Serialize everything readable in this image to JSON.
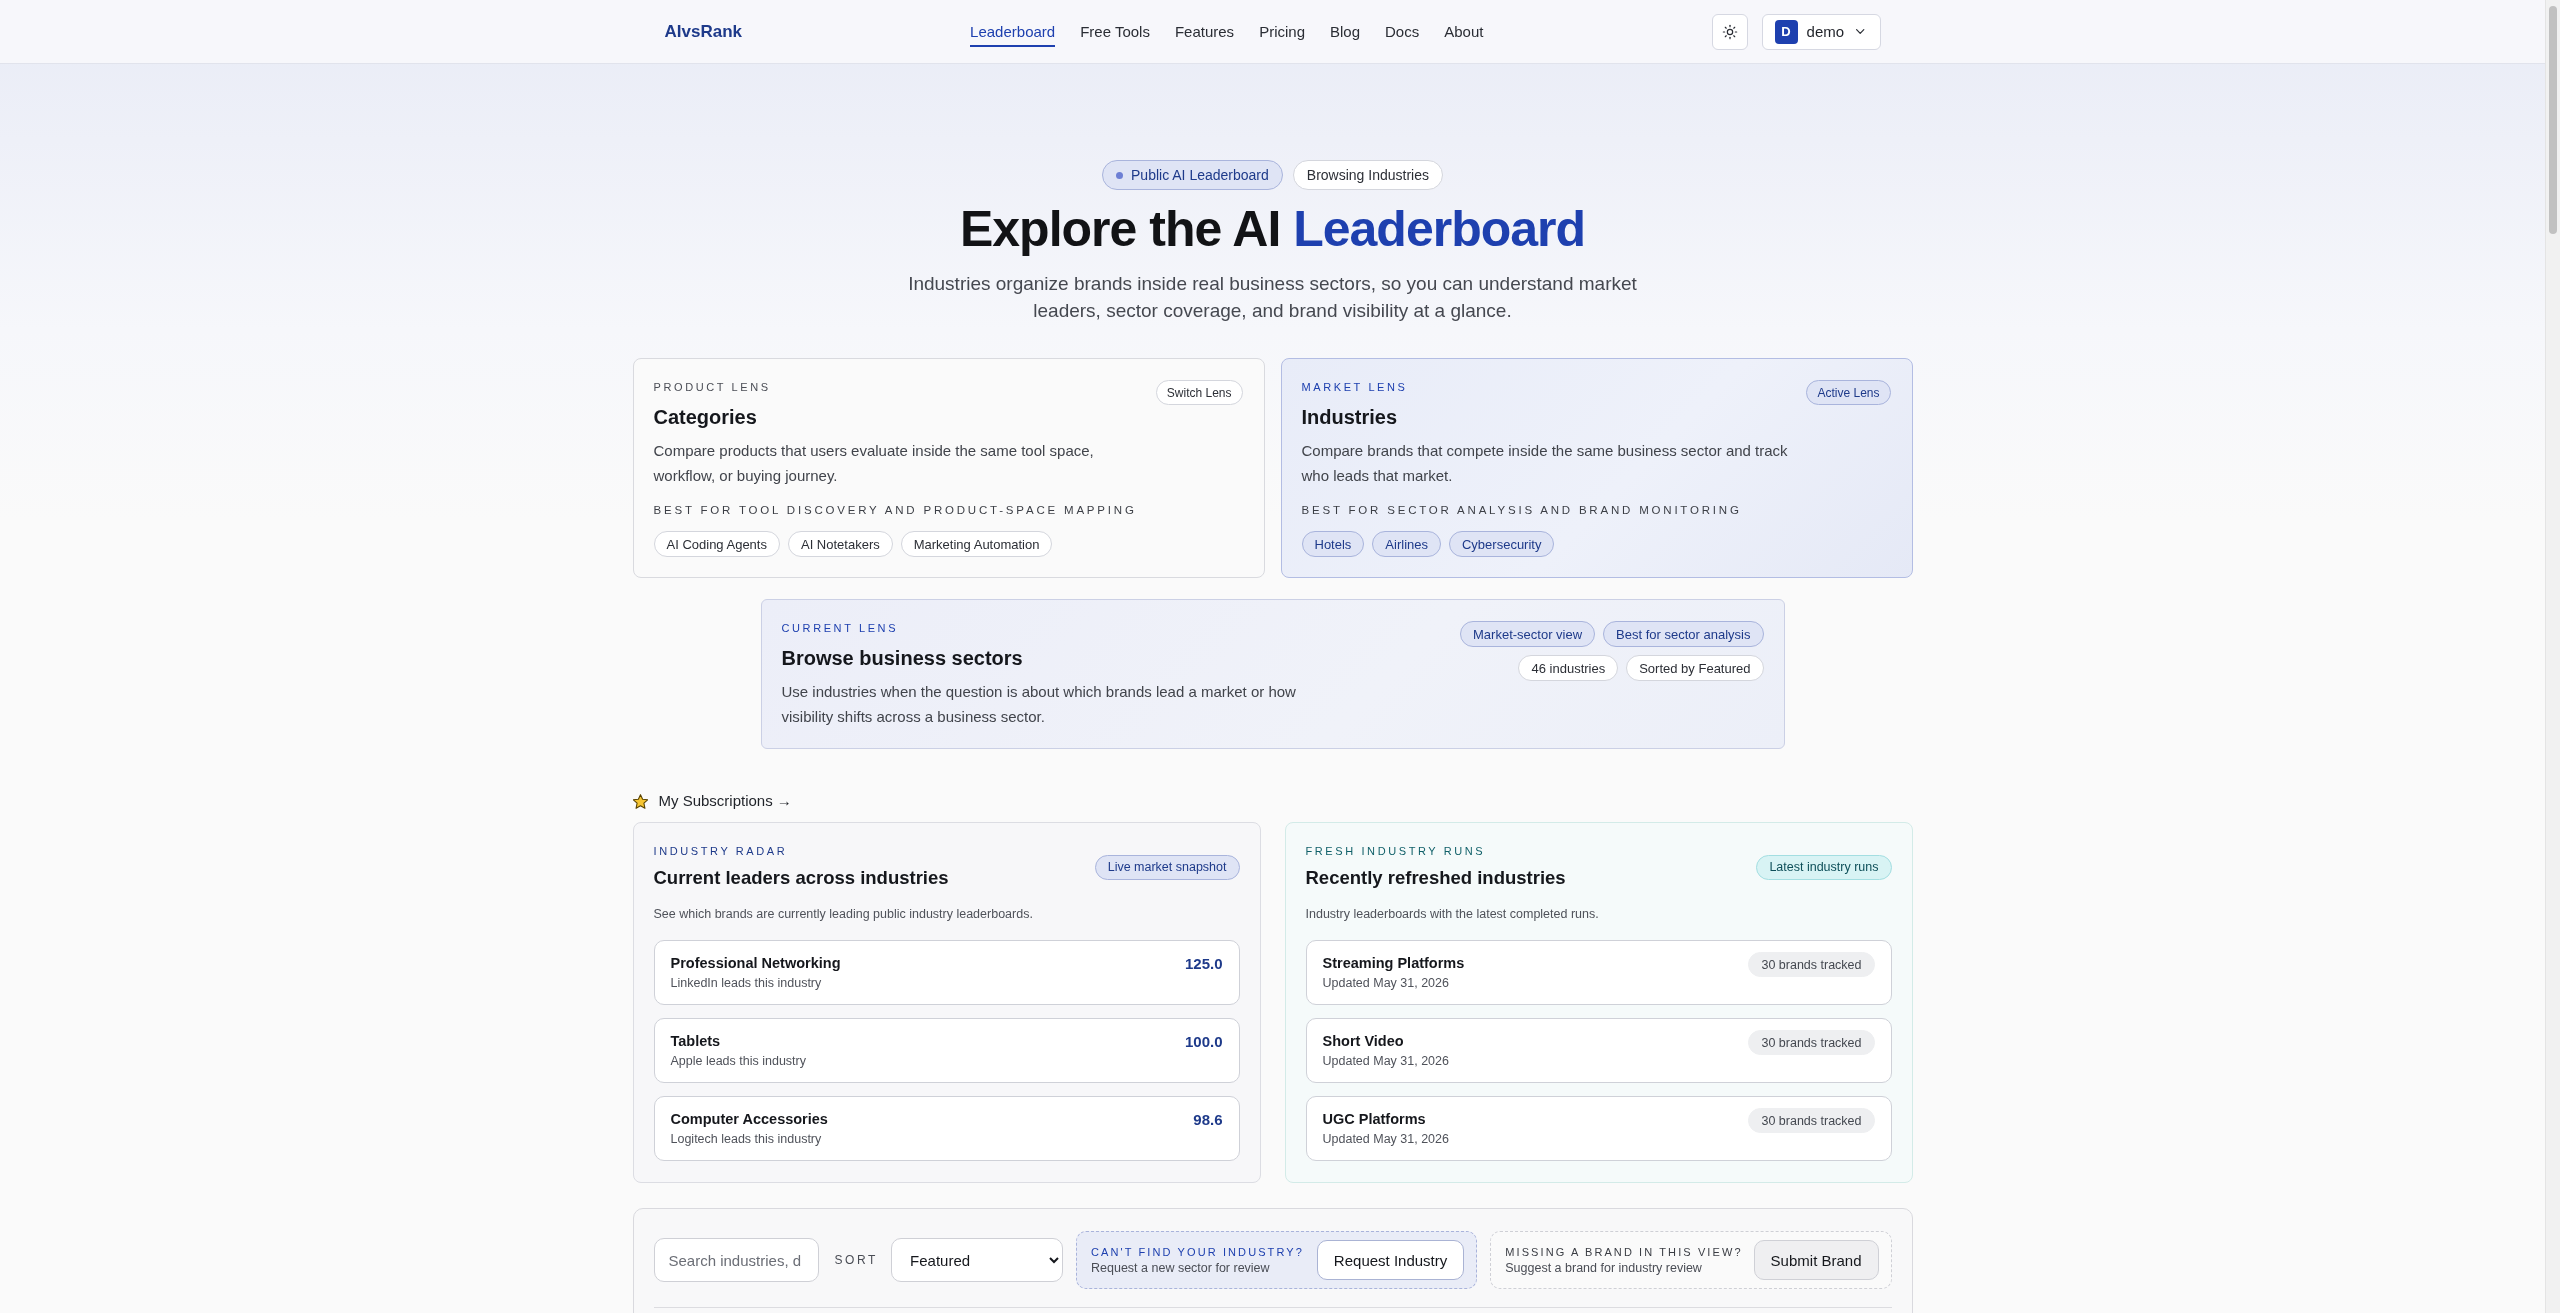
{
  "header": {
    "logo": "AIvsRank",
    "nav": [
      {
        "label": "Leaderboard",
        "selected": true
      },
      {
        "label": "Free Tools",
        "selected": false
      },
      {
        "label": "Features",
        "selected": false
      },
      {
        "label": "Pricing",
        "selected": false
      },
      {
        "label": "Blog",
        "selected": false
      },
      {
        "label": "Docs",
        "selected": false
      },
      {
        "label": "About",
        "selected": false
      }
    ],
    "account": {
      "initial": "D",
      "name": "demo"
    }
  },
  "hero": {
    "badges": [
      {
        "label": "Public AI Leaderboard",
        "kind": "accent"
      },
      {
        "label": "Browsing Industries",
        "kind": "plain"
      }
    ],
    "title": "Explore the AI",
    "title_highlight": "Leaderboard",
    "subtitle": "Industries organize brands inside real business sectors, so you can understand market leaders, sector coverage, and brand visibility at a glance."
  },
  "lenses": [
    {
      "eyebrow": "PRODUCT LENS",
      "title": "Categories",
      "status": "Switch Lens",
      "description": "Compare products that users evaluate inside the same tool space, workflow, or buying journey.",
      "best_for": "BEST FOR TOOL DISCOVERY AND PRODUCT-SPACE MAPPING",
      "examples": [
        "AI Coding Agents",
        "AI Notetakers",
        "Marketing Automation"
      ],
      "active": false
    },
    {
      "eyebrow": "MARKET LENS",
      "title": "Industries",
      "status": "Active Lens",
      "description": "Compare brands that compete inside the same business sector and track who leads that market.",
      "best_for": "BEST FOR SECTOR ANALYSIS AND BRAND MONITORING",
      "examples": [
        "Hotels",
        "Airlines",
        "Cybersecurity"
      ],
      "active": true
    }
  ],
  "current_lens": {
    "eyebrow": "CURRENT LENS",
    "title": "Browse business sectors",
    "description": "Use industries when the question is about which brands lead a market or how visibility shifts across a business sector.",
    "pill_rows": [
      [
        {
          "label": "Market-sector view",
          "kind": "accent"
        },
        {
          "label": "Best for sector analysis",
          "kind": "accent"
        }
      ],
      [
        {
          "label": "46 industries",
          "kind": "plain"
        },
        {
          "label": "Sorted by Featured",
          "kind": "plain"
        }
      ]
    ]
  },
  "subscriptions_link": "My Subscriptions →",
  "panels": [
    {
      "kind": "leaders",
      "eyebrow": "INDUSTRY RADAR",
      "title": "Current leaders across industries",
      "badge": "Live market snapshot",
      "description": "See which brands are currently leading public industry leaderboards.",
      "rows": [
        {
          "name": "Professional Networking",
          "detail": "LinkedIn leads this industry",
          "value": "125.0"
        },
        {
          "name": "Tablets",
          "detail": "Apple leads this industry",
          "value": "100.0"
        },
        {
          "name": "Computer Accessories",
          "detail": "Logitech leads this industry",
          "value": "98.6"
        }
      ]
    },
    {
      "kind": "recent",
      "eyebrow": "FRESH INDUSTRY RUNS",
      "title": "Recently refreshed industries",
      "badge": "Latest industry runs",
      "description": "Industry leaderboards with the latest completed runs.",
      "rows": [
        {
          "name": "Streaming Platforms",
          "detail": "Updated May 31, 2026",
          "value": "30 brands tracked"
        },
        {
          "name": "Short Video",
          "detail": "Updated May 31, 2026",
          "value": "30 brands tracked"
        },
        {
          "name": "UGC Platforms",
          "detail": "Updated May 31, 2026",
          "value": "30 brands tracked"
        }
      ]
    }
  ],
  "toolbar": {
    "search": {
      "placeholder": "Search industries, d"
    },
    "sort_label": "SORT",
    "sort": {
      "value": "Featured"
    },
    "prompts": [
      {
        "kind": "accent",
        "title": "CAN'T FIND YOUR INDUSTRY?",
        "subtitle": "Request a new sector for review",
        "button": "Request Industry"
      },
      {
        "kind": "plain",
        "title": "MISSING A BRAND IN THIS VIEW?",
        "subtitle": "Suggest a brand for industry review",
        "button": "Submit Brand"
      }
    ]
  }
}
